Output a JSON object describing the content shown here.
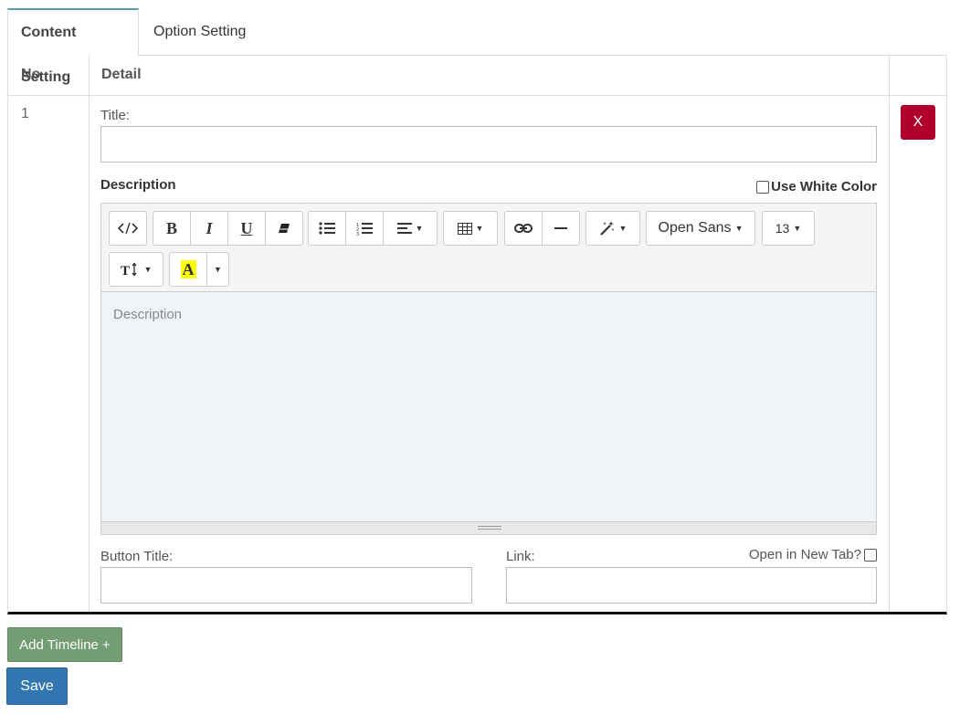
{
  "tabs": [
    {
      "label": "Content Setting",
      "active": true
    },
    {
      "label": "Option Setting",
      "active": false
    }
  ],
  "table": {
    "headers": {
      "no": "No",
      "detail": "Detail",
      "action": ""
    },
    "rows": [
      {
        "no": "1",
        "title_label": "Title:",
        "title_value": "",
        "description_label": "Description",
        "use_white_color_label": "Use White Color",
        "description_placeholder": "Description",
        "button_title_label": "Button Title:",
        "button_title_value": "",
        "link_label": "Link:",
        "link_value": "",
        "open_new_tab_label": "Open in New Tab?",
        "remove_label": "X"
      }
    ]
  },
  "editor": {
    "font_family_label": "Open Sans",
    "font_size_label": "13",
    "icons": [
      "code-view-icon",
      "bold-icon",
      "italic-icon",
      "underline-icon",
      "eraser-icon",
      "unordered-list-icon",
      "ordered-list-icon",
      "align-icon",
      "table-icon",
      "link-icon",
      "horizontal-rule-icon",
      "magic-wand-icon",
      "line-height-icon",
      "highlight-color-icon"
    ]
  },
  "actions": {
    "add_timeline_label": "Add Timeline +",
    "save_label": "Save"
  },
  "colors": {
    "remove_button": "#b1002b",
    "add_button": "#739e73",
    "save_button": "#3276b1",
    "tab_accent": "#5b9aa9",
    "editor_background": "#f0f4f9",
    "highlight_yellow": "#ffff00"
  }
}
